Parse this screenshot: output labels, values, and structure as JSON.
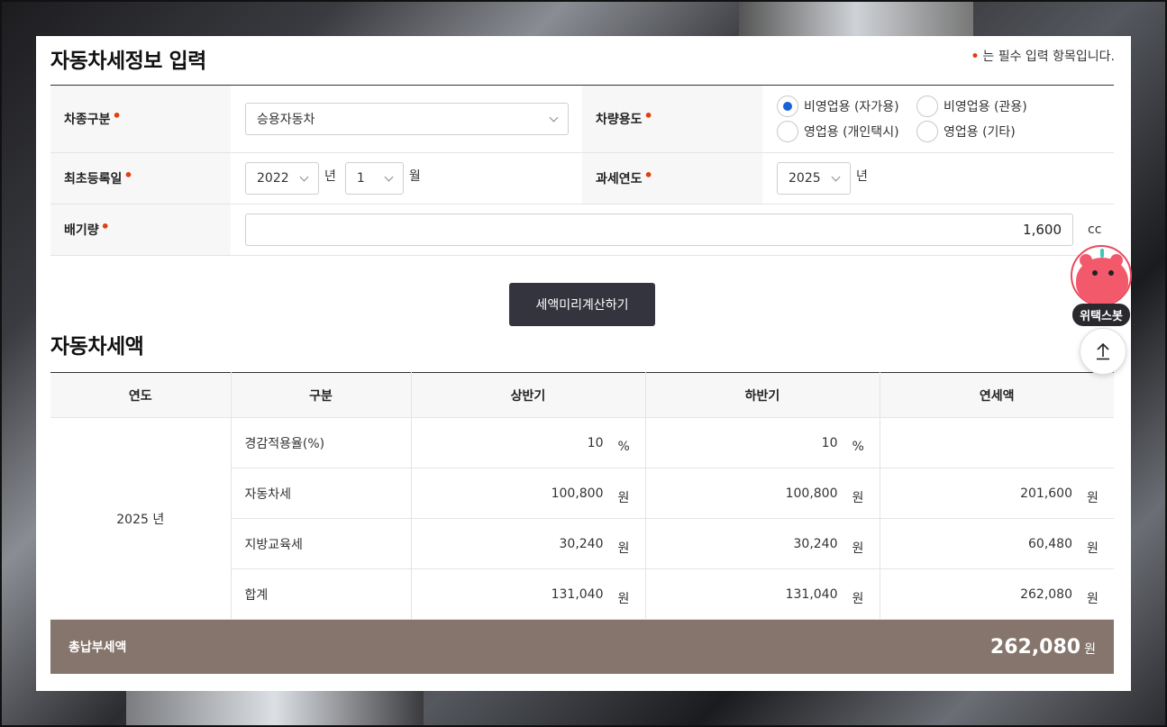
{
  "section1": {
    "title": "자동차세정보 입력",
    "required_note": "는 필수 입력 항목입니다.",
    "required_mark": "•"
  },
  "form": {
    "vehicle_type": {
      "label": "차종구분",
      "value": "승용자동차"
    },
    "vehicle_use": {
      "label": "차량용도",
      "options": [
        {
          "label": "비영업용 (자가용)",
          "selected": true
        },
        {
          "label": "비영업용 (관용)",
          "selected": false
        },
        {
          "label": "영업용 (개인택시)",
          "selected": false
        },
        {
          "label": "영업용 (기타)",
          "selected": false
        }
      ]
    },
    "first_registration": {
      "label": "최초등록일",
      "year": "2022",
      "year_unit": "년",
      "month": "1",
      "month_unit": "월"
    },
    "tax_year": {
      "label": "과세연도",
      "value": "2025",
      "unit": "년"
    },
    "displacement": {
      "label": "배기량",
      "value": "1,600",
      "unit": "cc"
    }
  },
  "calc_button": "세액미리계산하기",
  "section2": {
    "title": "자동차세액"
  },
  "result_table": {
    "headers": [
      "연도",
      "구분",
      "상반기",
      "하반기",
      "연세액"
    ],
    "year": "2025 년",
    "rows": [
      {
        "label": "경감적용율(%)",
        "first": "10",
        "first_unit": "%",
        "second": "10",
        "second_unit": "%",
        "annual": "",
        "annual_unit": ""
      },
      {
        "label": "자동차세",
        "first": "100,800",
        "first_unit": "원",
        "second": "100,800",
        "second_unit": "원",
        "annual": "201,600",
        "annual_unit": "원"
      },
      {
        "label": "지방교육세",
        "first": "30,240",
        "first_unit": "원",
        "second": "30,240",
        "second_unit": "원",
        "annual": "60,480",
        "annual_unit": "원"
      },
      {
        "label": "합계",
        "first": "131,040",
        "first_unit": "원",
        "second": "131,040",
        "second_unit": "원",
        "annual": "262,080",
        "annual_unit": "원"
      }
    ]
  },
  "total": {
    "label": "총납부세액",
    "amount": "262,080",
    "unit": "원"
  },
  "chatbot": {
    "label": "위택스봇"
  },
  "colors": {
    "accent_dot": "#e0400e",
    "radio_on": "#1a62d6",
    "button_bg": "#33343e",
    "total_bg": "#85756c"
  }
}
